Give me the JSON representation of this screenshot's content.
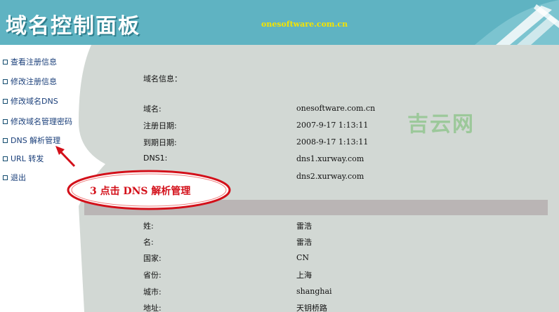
{
  "header": {
    "title": "域名控制面板",
    "domain": "onesoftware.com.cn"
  },
  "sidebar": {
    "items": [
      {
        "label": "查看注册信息"
      },
      {
        "label": "修改注册信息"
      },
      {
        "label": "修改域名DNS"
      },
      {
        "label": "修改域名管理密码"
      },
      {
        "label": "DNS 解析管理"
      },
      {
        "label": "URL 转发"
      },
      {
        "label": "退出"
      }
    ]
  },
  "main": {
    "section_title": "域名信息：",
    "domain_rows": [
      {
        "label": "域名:",
        "value": "onesoftware.com.cn"
      },
      {
        "label": "注册日期:",
        "value": "2007-9-17 1:13:11"
      },
      {
        "label": "到期日期:",
        "value": "2008-9-17 1:13:11"
      },
      {
        "label": "DNS1:",
        "value": "dns1.xurway.com"
      },
      {
        "label": "",
        "value": "dns2.xurway.com"
      }
    ],
    "owner_rows": [
      {
        "label": "姓:",
        "value": "雷浩"
      },
      {
        "label": "名:",
        "value": "雷浩"
      },
      {
        "label": "国家:",
        "value": "CN"
      },
      {
        "label": "省份:",
        "value": "上海"
      },
      {
        "label": "城市:",
        "value": "shanghai"
      },
      {
        "label": "地址:",
        "value": "天钥桥路"
      }
    ]
  },
  "watermark": "吉云网",
  "annotation": {
    "text": "3  点击 DNS 解析管理"
  },
  "colors": {
    "header_bg": "#5fb3c2",
    "page_bg": "#d2d8d4",
    "sidebar_bg": "#ffffff",
    "annotation": "#d3101a",
    "domain_text": "#f5e400"
  }
}
